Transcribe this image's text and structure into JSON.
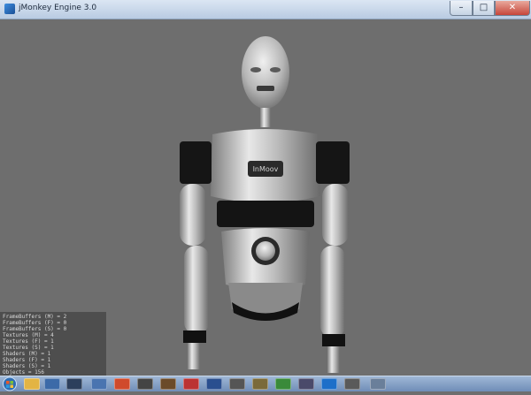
{
  "window": {
    "title": "jMonkey Engine 3.0",
    "buttons": {
      "minimize": "–",
      "maximize": "□",
      "close": "✕"
    }
  },
  "scene": {
    "background_color": "#6e6e6e",
    "model_colors": {
      "chrome": "#c9c9c9",
      "dark": "#1a1a1a",
      "mid": "#9a9a9a"
    },
    "chest_logo": "InMoov"
  },
  "stats": {
    "lines": [
      "FrameBuffers (M) = 2",
      "FrameBuffers (F) = 0",
      "FrameBuffers (S) = 0",
      "Textures (M) = 4",
      "Textures (F) = 1",
      "Textures (S) = 1",
      "Shaders (M) = 1",
      "Shaders (F) = 1",
      "Shaders (S) = 1",
      "Objects = 156"
    ]
  },
  "taskbar": {
    "icons": [
      "start-orb",
      "explorer",
      "media",
      "chrome",
      "folder",
      "network",
      "paint",
      "java",
      "netbeans",
      "terminal",
      "settings",
      "firefox",
      "outlook",
      "tool",
      "desktop"
    ],
    "colors": {
      "bar": "#7e9cc4"
    }
  }
}
